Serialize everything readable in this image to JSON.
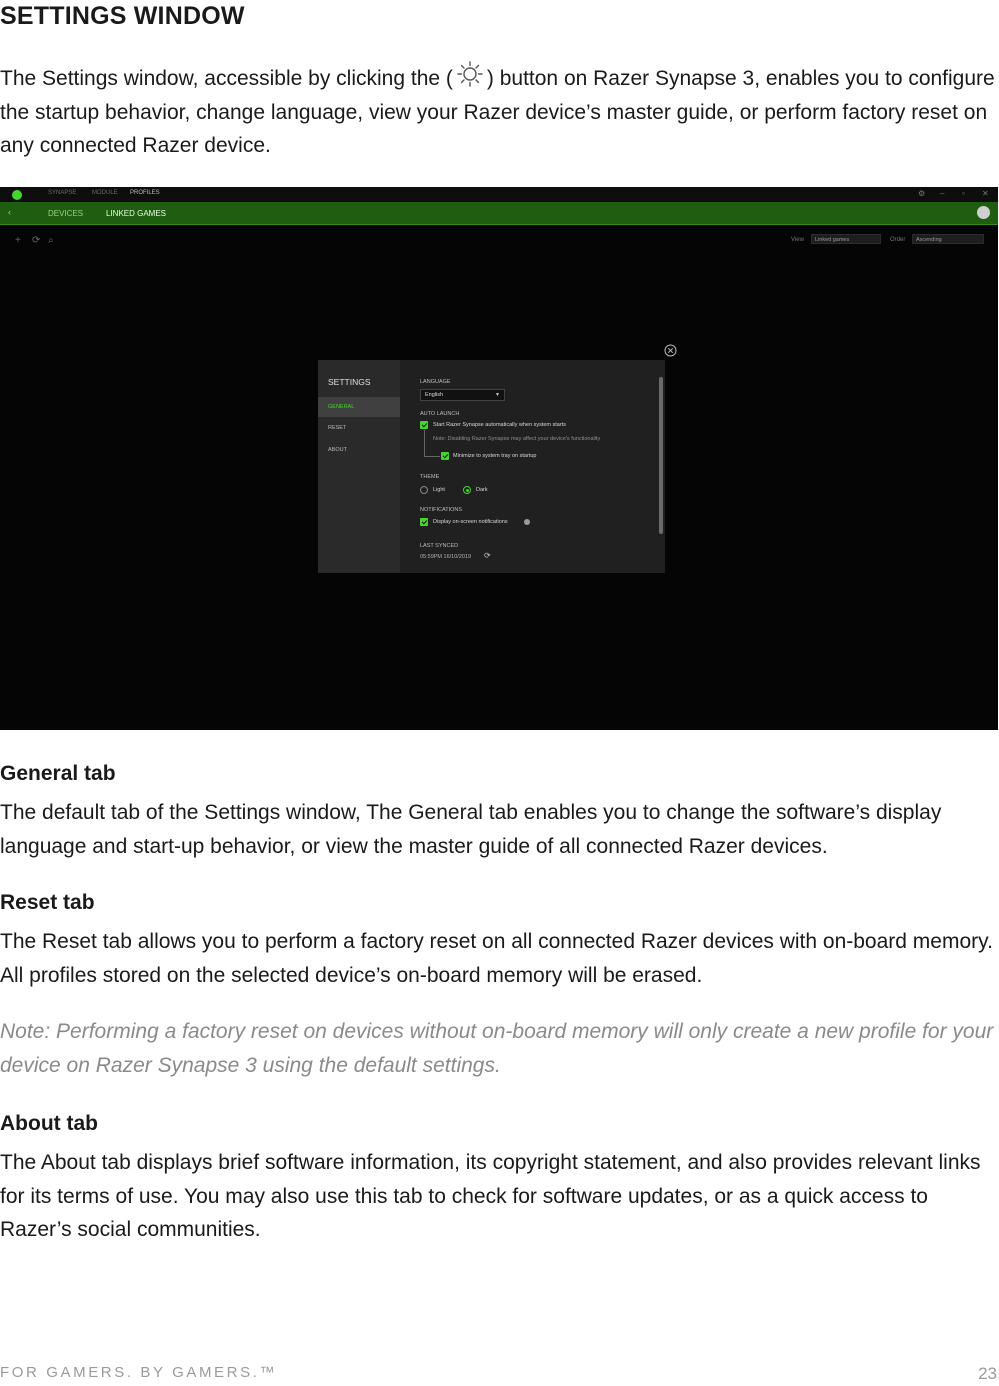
{
  "heading": "SETTINGS WINDOW",
  "intro": {
    "before_icon": "The Settings window, accessible by clicking the (",
    "icon": "gear-icon",
    "after_icon": ") button on Razer Synapse 3, enables you to configure the startup behavior, change language, view your Razer device’s master guide, or perform factory reset on any connected Razer device."
  },
  "screenshot": {
    "top_tabs": [
      "SYNAPSE",
      "MODULE",
      "PROFILES"
    ],
    "sub_tabs": [
      "DEVICES",
      "LINKED GAMES"
    ],
    "view_label": "View",
    "view_value": "Linked games",
    "order_label": "Order",
    "order_value": "Ascending",
    "dialog": {
      "title": "SETTINGS",
      "nav": [
        "GENERAL",
        "RESET",
        "ABOUT"
      ],
      "language_label": "LANGUAGE",
      "language_value": "English",
      "auto_launch_label": "AUTO LAUNCH",
      "auto_launch_option": "Start Razer Synapse automatically when system starts",
      "auto_launch_note": "Note: Disabling Razer Synapse may affect your device's functionality",
      "minimize_option": "Minimize to system tray on startup",
      "theme_label": "THEME",
      "theme_light": "Light",
      "theme_dark": "Dark",
      "notifications_label": "NOTIFICATIONS",
      "notifications_option": "Display on-screen notifications",
      "last_synced_label": "LAST SYNCED",
      "last_synced_value": "05:59PM 16/10/2019"
    }
  },
  "general": {
    "title": "General tab",
    "body": "The default tab of the Settings window, The General tab enables you to change the software’s display language and start-up behavior, or view the master guide of all connected Razer devices."
  },
  "reset": {
    "title": "Reset tab",
    "body": "The Reset tab allows you to perform a factory reset on all connected Razer devices with on-board memory. All profiles stored on the selected device’s on-board memory will be erased.",
    "note": "Note: Performing a factory reset on devices without on-board memory will only create a new profile for your device on Razer Synapse 3 using the default settings."
  },
  "about": {
    "title": "About tab",
    "body": "The About tab displays brief software information, its copyright statement, and also provides relevant links for its terms of use.  You may also use this tab to check for software updates, or as a quick access to Razer’s social communities."
  },
  "footer": {
    "tagline": "FOR GAMERS. BY GAMERS.™",
    "page": "23"
  },
  "colors": {
    "razer_green": "#44d62c",
    "note_gray": "#8a8a8a"
  }
}
